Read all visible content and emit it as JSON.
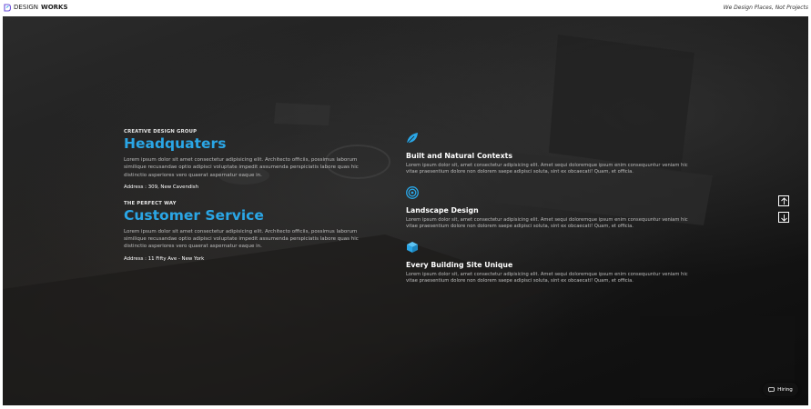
{
  "header": {
    "logo": {
      "design": "DESIGN",
      "works": "WORKS"
    },
    "tagline": "We Design Places, Not Projects"
  },
  "offices": [
    {
      "kicker": "CREATIVE DESIGN GROUP",
      "title": "Headquaters",
      "text": "Lorem ipsum dolor sit amet consectetur adipisicing elit. Architecto officiis, possimus laborum similique recusandae optio adipisci voluptate impedit assumenda perspiciatis labore quas hic distinctio asperiores vero quaerat aspernatur eaque in.",
      "address": "Address : 309, New Cavendish"
    },
    {
      "kicker": "THE PERFECT WAY",
      "title": "Customer Service",
      "text": "Lorem ipsum dolor sit amet consectetur adipisicing elit. Architecto officiis, possimus laborum similique recusandae optio adipisci voluptate impedit assumenda perspiciatis labore quas hic distinctio asperiores vero quaerat aspernatur eaque in.",
      "address": "Address : 11 Fifty Ave - New York"
    }
  ],
  "features": [
    {
      "icon": "leaf-icon",
      "title": "Built and Natural Contexts",
      "text": "Lorem ipsum dolor sit, amet consectetur adipisicing elit. Amet sequi doloremque ipsum enim consequuntur veniam hic vitae praesentium dolore non dolorem saepe adipisci soluta, sint ex obcaecati! Quam, et officia."
    },
    {
      "icon": "target-icon",
      "title": "Landscape Design",
      "text": "Lorem ipsum dolor sit, amet consectetur adipisicing elit. Amet sequi doloremque ipsum enim consequuntur veniam hic vitae praesentium dolore non dolorem saepe adipisci soluta, sint ex obcaecati! Quam, et officia."
    },
    {
      "icon": "cube-icon",
      "title": "Every Building Site Unique",
      "text": "Lorem ipsum dolor sit, amet consectetur adipisicing elit. Amet sequi doloremque ipsum enim consequuntur veniam hic vitae praesentium dolore non dolorem saepe adipisci soluta, sint ex obcaecati! Quam, et officia."
    }
  ],
  "nav": {
    "up": "arrow-up-icon",
    "down": "arrow-down-icon"
  },
  "hiring": {
    "label": "Hiring",
    "icon": "chat-icon"
  },
  "colors": {
    "accent": "#2aa6e6",
    "background": "#1a1a1a"
  }
}
